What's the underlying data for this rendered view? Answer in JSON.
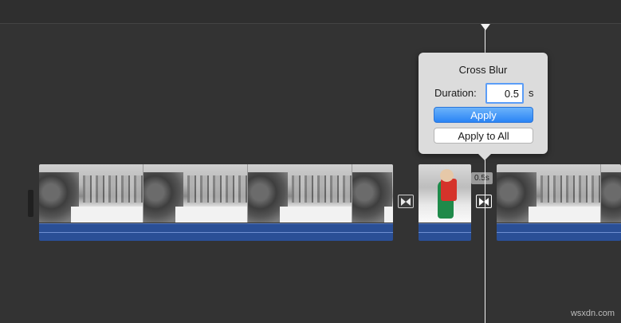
{
  "popover": {
    "title": "Cross Blur",
    "duration_label": "Duration:",
    "duration_value": "0.5",
    "duration_unit": "s",
    "apply_label": "Apply",
    "apply_all_label": "Apply to All"
  },
  "timeline": {
    "transition_duration_badge": "0.5s"
  },
  "watermark": "wsxdn.com",
  "colors": {
    "background": "#333333",
    "audio_track": "#2a4f96",
    "apply_button": "#2a84f5",
    "playhead": "#f4f4f4"
  },
  "icons": {
    "transition": "cross-transition-icon",
    "playhead": "playhead-triangle-icon"
  }
}
